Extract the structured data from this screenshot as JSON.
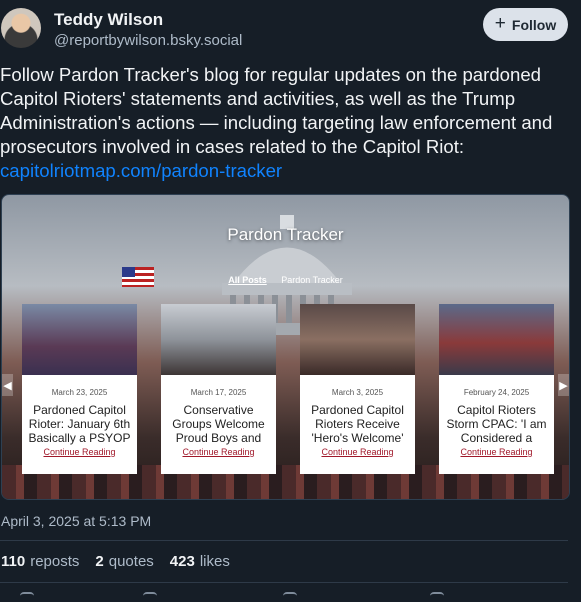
{
  "author": {
    "display_name": "Teddy Wilson",
    "handle": "@reportbywilson.bsky.social"
  },
  "follow_button": {
    "icon": "plus-icon",
    "label": "Follow"
  },
  "post": {
    "text": "Follow Pardon Tracker's blog for regular updates on the pardoned Capitol Rioters' statements and activities, as well as the Trump Administration's actions — including targeting law enforcement and prosecutors involved in cases related to the Capitol Riot: ",
    "link_text": "capitolriotmap.com/pardon-tracker"
  },
  "embed": {
    "site_title": "Pardon Tracker",
    "nav": [
      "All Posts",
      "Pardon Tracker"
    ],
    "cards": [
      {
        "date": "March 23, 2025",
        "title": "Pardoned Capitol Rioter: January 6th Basically a PSYOP",
        "link": "Continue Reading"
      },
      {
        "date": "March 17, 2025",
        "title": "Conservative Groups Welcome Proud Boys and",
        "link": "Continue Reading"
      },
      {
        "date": "March 3, 2025",
        "title": "Pardoned Capitol Rioters Receive 'Hero's Welcome'",
        "link": "Continue Reading"
      },
      {
        "date": "February 24, 2025",
        "title": "Capitol Rioters Storm CPAC: 'I am Considered a",
        "link": "Continue Reading"
      }
    ],
    "prev_icon": "chevron-left-icon",
    "next_icon": "chevron-right-icon"
  },
  "timestamp": "April 3, 2025 at 5:13 PM",
  "stats": {
    "reposts_count": "110",
    "reposts_label": "reposts",
    "quotes_count": "2",
    "quotes_label": "quotes",
    "likes_count": "423",
    "likes_label": "likes"
  },
  "colors": {
    "background": "#161e27",
    "link": "#1083fe",
    "muted": "#aebbc9",
    "follow_bg": "#dce2ea"
  }
}
